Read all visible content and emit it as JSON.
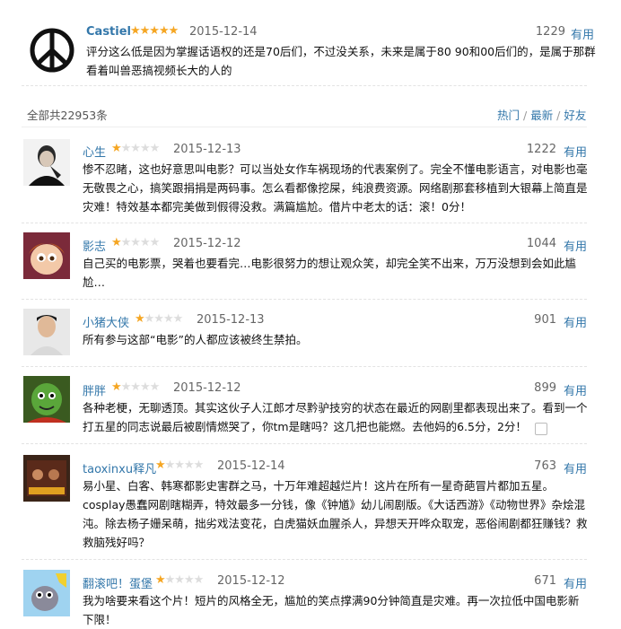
{
  "top_review": {
    "user": "Castiel",
    "rating_stars": 5,
    "date": "2015-12-14",
    "votes": "1229",
    "useful_label": "有用",
    "text": "评分这么低是因为掌握话语权的还是70后们，不过没关系，未来是属于80 90和00后们的，是属于那群看着叫兽恶搞视频长大的人的"
  },
  "summary": {
    "total": "全部共22953条",
    "sort_hot": "热门",
    "sort_new": "最新",
    "sort_friends": "好友",
    "separator": " / "
  },
  "comments": [
    {
      "user": "心生",
      "rating_stars": 1,
      "date": "2015-12-13",
      "votes": "1222",
      "useful_label": "有用",
      "text": "惨不忍睹，这也好意思叫电影？可以当处女作车祸现场的代表案例了。完全不懂电影语言，对电影也毫无敬畏之心，搞笑跟捐捐是两码事。怎么看都像挖屎，纯浪费资源。网络剧那套移植到大银幕上简直是灾难！特效基本都完美做到假得没救。满篇尴尬。借片中老太的话：滚！0分！"
    },
    {
      "user": "影志",
      "rating_stars": 1,
      "date": "2015-12-12",
      "votes": "1044",
      "useful_label": "有用",
      "text": "自己买的电影票，哭着也要看完…电影很努力的想让观众笑，却完全笑不出来，万万没想到会如此尴尬…"
    },
    {
      "user": "小猪大侠",
      "rating_stars": 1,
      "date": "2015-12-13",
      "votes": "901",
      "useful_label": "有用",
      "text": "所有参与这部“电影”的人都应该被终生禁拍。"
    },
    {
      "user": "胖胖",
      "rating_stars": 1,
      "date": "2015-12-12",
      "votes": "899",
      "useful_label": "有用",
      "text": "各种老梗，无聊透顶。其实这伙子人江郎才尽黔驴技穷的状态在最近的网剧里都表现出来了。看到一个打五星的同志说最后被剧情燃哭了，你tm是瞎吗？这几把也能燃。去他妈的6.5分，2分！"
    },
    {
      "user": "taoxinxu释凡",
      "rating_stars": 1,
      "date": "2015-12-14",
      "votes": "763",
      "useful_label": "有用",
      "text": "易小星、白客、韩寒都影史害群之马，十万年难超越烂片！这片在所有一星奇葩冒片都加五星。cosplay愚蠢网剧瞎糊弄，特效最多一分钱，像《钟馗》幼儿闹剧版。《大话西游》《动物世界》杂烩混沌。除去杨子姗呆萌，拙劣戏法变花，白虎猫妖血腥杀人，异想天开哗众取宠，恶俗闹剧都狂赚钱？救救脑残好吗？"
    },
    {
      "user": "翻滚吧！蛋堡",
      "rating_stars": 1,
      "date": "2015-12-12",
      "votes": "671",
      "useful_label": "有用",
      "text": "我为啥要来看这个片！短片的风格全无，尴尬的笑点撑满90分钟简直是灾难。再一次拉低中国电影新下限！"
    }
  ]
}
